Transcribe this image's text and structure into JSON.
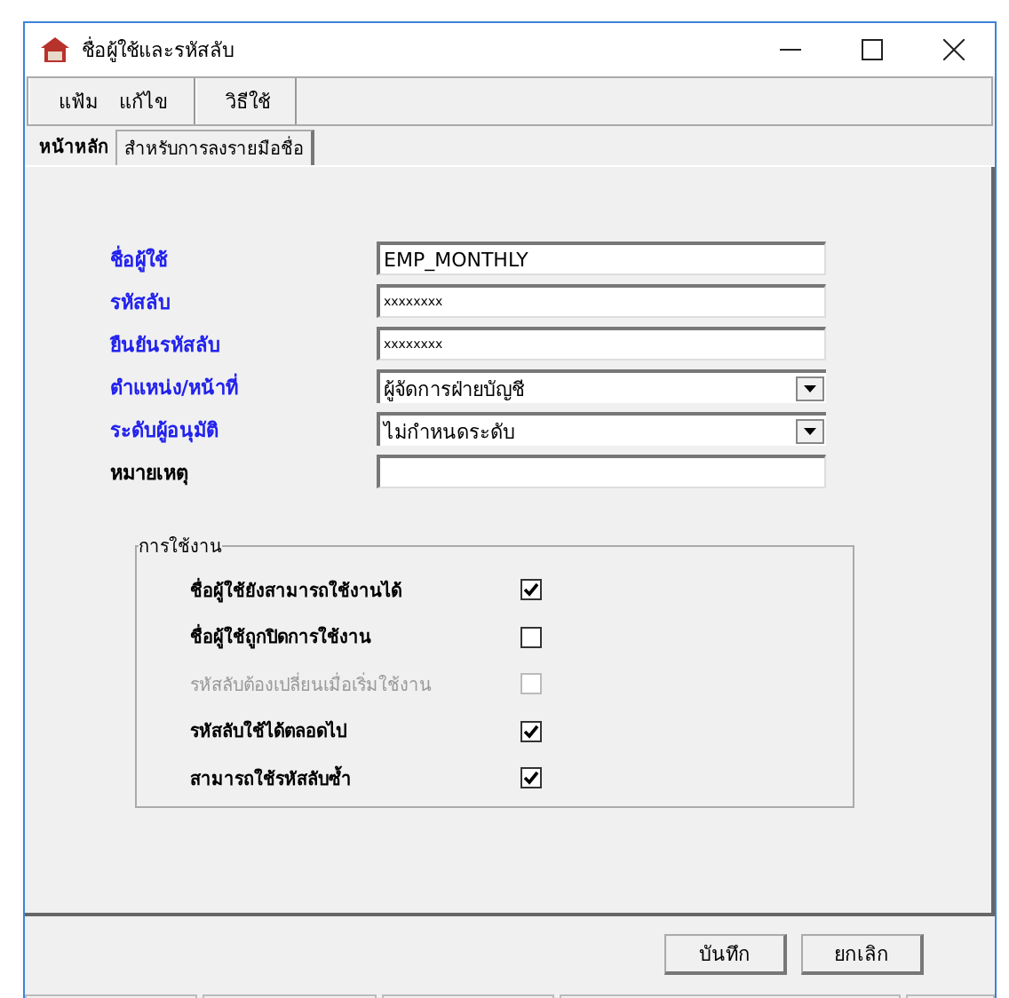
{
  "window": {
    "title": "ชื่อผู้ใช้และรหัสลับ"
  },
  "menu_groups": [
    [
      "แฟ้ม",
      "แก้ไข"
    ],
    [
      "วิธีใช้"
    ]
  ],
  "tabs": [
    {
      "label": "หน้าหลัก",
      "selected": true
    },
    {
      "label": "สำหรับการลงรายมือชื่อ",
      "selected": false
    }
  ],
  "fields": [
    {
      "kind": "text",
      "label": "ชื่อผู้ใช้",
      "value": "EMP_MONTHLY",
      "highlighted": true
    },
    {
      "kind": "password",
      "label": "รหัสลับ",
      "value": "xxxxxxxx",
      "highlighted": true
    },
    {
      "kind": "password",
      "label": "ยืนยันรหัสลับ",
      "value": "xxxxxxxx",
      "highlighted": true
    },
    {
      "kind": "dropdown",
      "label": "ตำแหน่ง/หน้าที่",
      "value": "ผู้จัดการฝ่ายบัญชี",
      "highlighted": true
    },
    {
      "kind": "dropdown",
      "label": "ระดับผู้อนุมัติ",
      "value": "ไม่กำหนดระดับ",
      "highlighted": true
    },
    {
      "kind": "text",
      "label": "หมายเหตุ",
      "highlighted": false
    }
  ],
  "usage_group": {
    "title": "การใช้งาน",
    "options": [
      {
        "label": "ชื่อผู้ใช้ยังสามารถใช้งานได้",
        "checked": true,
        "disabled": false
      },
      {
        "label": "ชื่อผู้ใช้ถูกปิดการใช้งาน",
        "checked": false,
        "disabled": false
      },
      {
        "label": "รหัสลับต้องเปลี่ยนเมื่อเริ่มใช้งาน",
        "checked": false,
        "disabled": true
      },
      {
        "label": "รหัสลับใช้ได้ตลอดไป",
        "checked": true,
        "disabled": false
      },
      {
        "label": "สามารถใช้รหัสลับซ้ำ",
        "checked": true,
        "disabled": false
      }
    ]
  },
  "buttons": [
    "บันทึก",
    "ยกเลิก"
  ]
}
